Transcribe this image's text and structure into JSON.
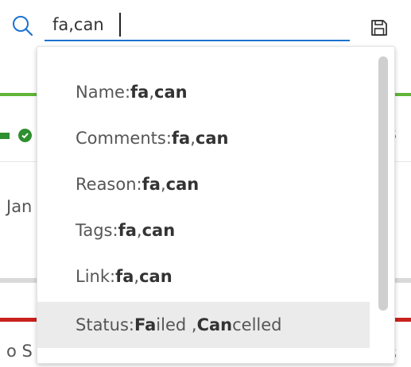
{
  "search": {
    "value": "fa,can",
    "placeholder": ""
  },
  "icons": {
    "search": "search-icon",
    "save": "save-icon",
    "status": "check-circle-icon"
  },
  "background": {
    "text_jan": "Jan",
    "text_os": "o S",
    "text_s1": "s",
    "text_s2": "s"
  },
  "colors": {
    "accent": "#1b72cf",
    "success": "#62b537",
    "danger": "#c9211e",
    "highlight": "#ebebeb"
  },
  "dropdown": {
    "items": [
      {
        "field": "Name:",
        "parts": [
          {
            "t": "fa",
            "b": true
          },
          {
            "t": ",",
            "b": false
          },
          {
            "t": "can",
            "b": true
          }
        ]
      },
      {
        "field": "Comments:",
        "parts": [
          {
            "t": "fa",
            "b": true
          },
          {
            "t": ",",
            "b": false
          },
          {
            "t": "can",
            "b": true
          }
        ]
      },
      {
        "field": "Reason:",
        "parts": [
          {
            "t": "fa",
            "b": true
          },
          {
            "t": ",",
            "b": false
          },
          {
            "t": "can",
            "b": true
          }
        ]
      },
      {
        "field": "Tags:",
        "parts": [
          {
            "t": "fa",
            "b": true
          },
          {
            "t": ",",
            "b": false
          },
          {
            "t": "can",
            "b": true
          }
        ]
      },
      {
        "field": "Link:",
        "parts": [
          {
            "t": "fa",
            "b": true
          },
          {
            "t": ",",
            "b": false
          },
          {
            "t": "can",
            "b": true
          }
        ]
      },
      {
        "field": "Status:",
        "highlighted": true,
        "parts": [
          {
            "t": "Fa",
            "b": true
          },
          {
            "t": "iled ,",
            "b": false
          },
          {
            "t": "Can",
            "b": true
          },
          {
            "t": "celled",
            "b": false
          }
        ]
      }
    ]
  }
}
